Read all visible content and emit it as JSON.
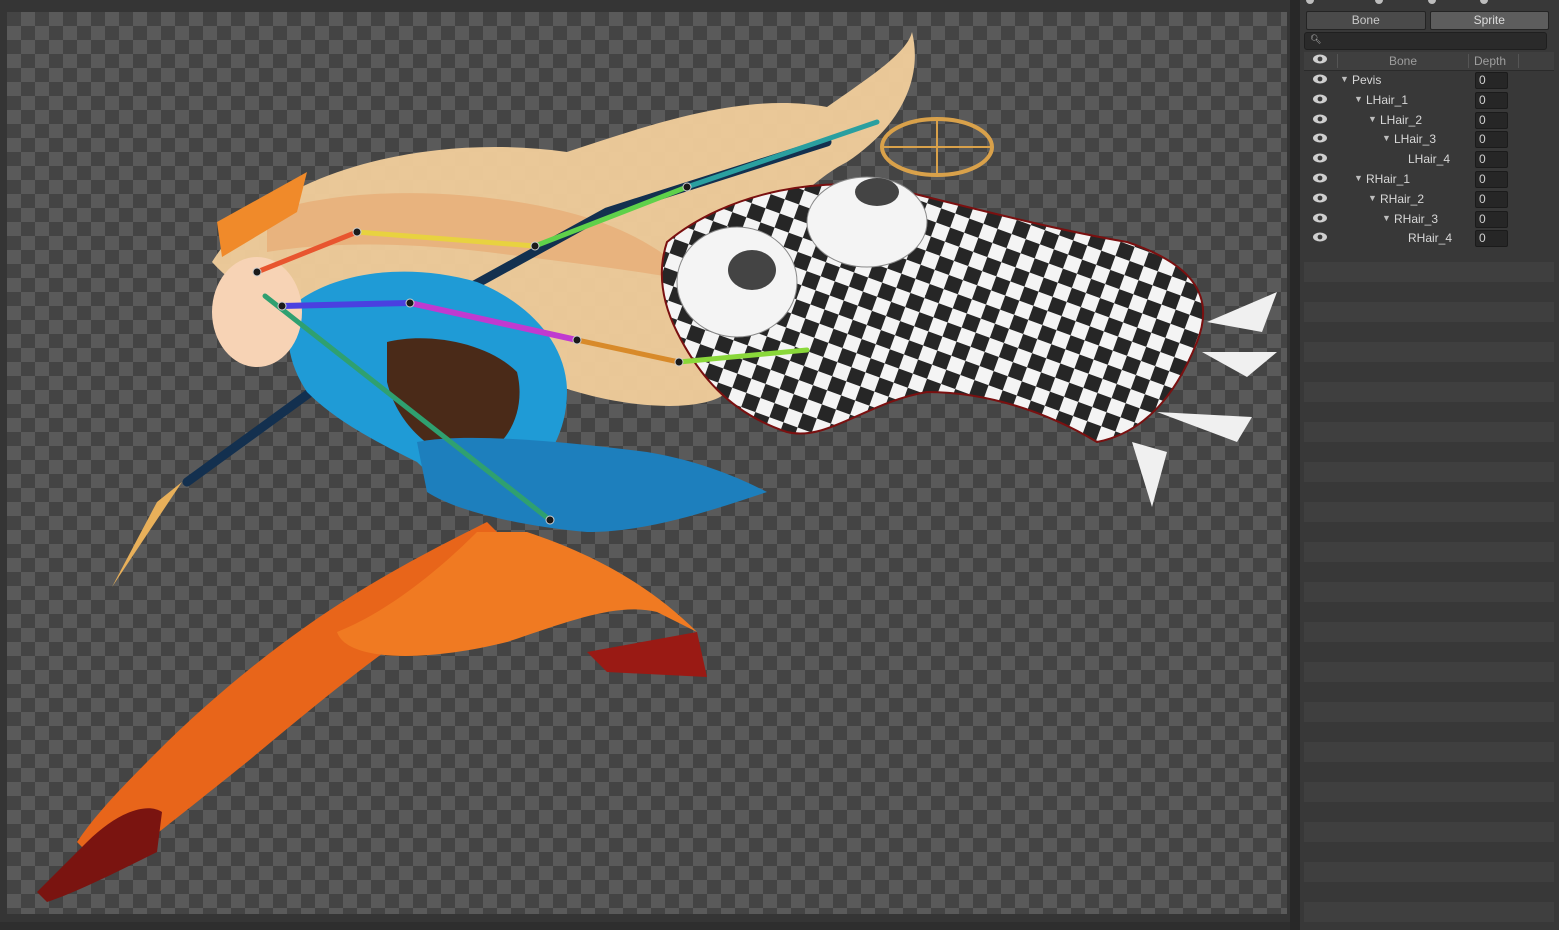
{
  "tabs": [
    {
      "label": "Bone",
      "active": false
    },
    {
      "label": "Sprite",
      "active": true
    }
  ],
  "search": {
    "placeholder": ""
  },
  "table": {
    "headers": {
      "visibility": "eye-icon",
      "bone": "Bone",
      "depth": "Depth"
    },
    "rows": [
      {
        "name": "Pevis",
        "level": 0,
        "expanded": true,
        "depth": "0"
      },
      {
        "name": "LHair_1",
        "level": 1,
        "expanded": true,
        "depth": "0"
      },
      {
        "name": "LHair_2",
        "level": 2,
        "expanded": true,
        "depth": "0"
      },
      {
        "name": "LHair_3",
        "level": 3,
        "expanded": true,
        "depth": "0"
      },
      {
        "name": "LHair_4",
        "level": 4,
        "expanded": null,
        "depth": "0"
      },
      {
        "name": "RHair_1",
        "level": 1,
        "expanded": true,
        "depth": "0"
      },
      {
        "name": "RHair_2",
        "level": 2,
        "expanded": true,
        "depth": "0"
      },
      {
        "name": "RHair_3",
        "level": 3,
        "expanded": true,
        "depth": "0"
      },
      {
        "name": "RHair_4",
        "level": 4,
        "expanded": null,
        "depth": "0"
      }
    ]
  },
  "canvas": {
    "description_icon": "character-sprite",
    "bones": [
      {
        "name": "head-bone",
        "color": "#e8552f"
      },
      {
        "name": "hair-bone-yellow",
        "color": "#e8d240"
      },
      {
        "name": "hair-bone-green",
        "color": "#5fd14a"
      },
      {
        "name": "hair-bone-teal",
        "color": "#2a9fa0"
      },
      {
        "name": "face-bone-blue",
        "color": "#4a40e0"
      },
      {
        "name": "face-bone-purple",
        "color": "#c03ad0"
      },
      {
        "name": "hair-bone-orange",
        "color": "#d88a2a"
      },
      {
        "name": "hair-bone-lime",
        "color": "#8ad83a"
      },
      {
        "name": "body-bone-green",
        "color": "#2fa070"
      }
    ]
  }
}
